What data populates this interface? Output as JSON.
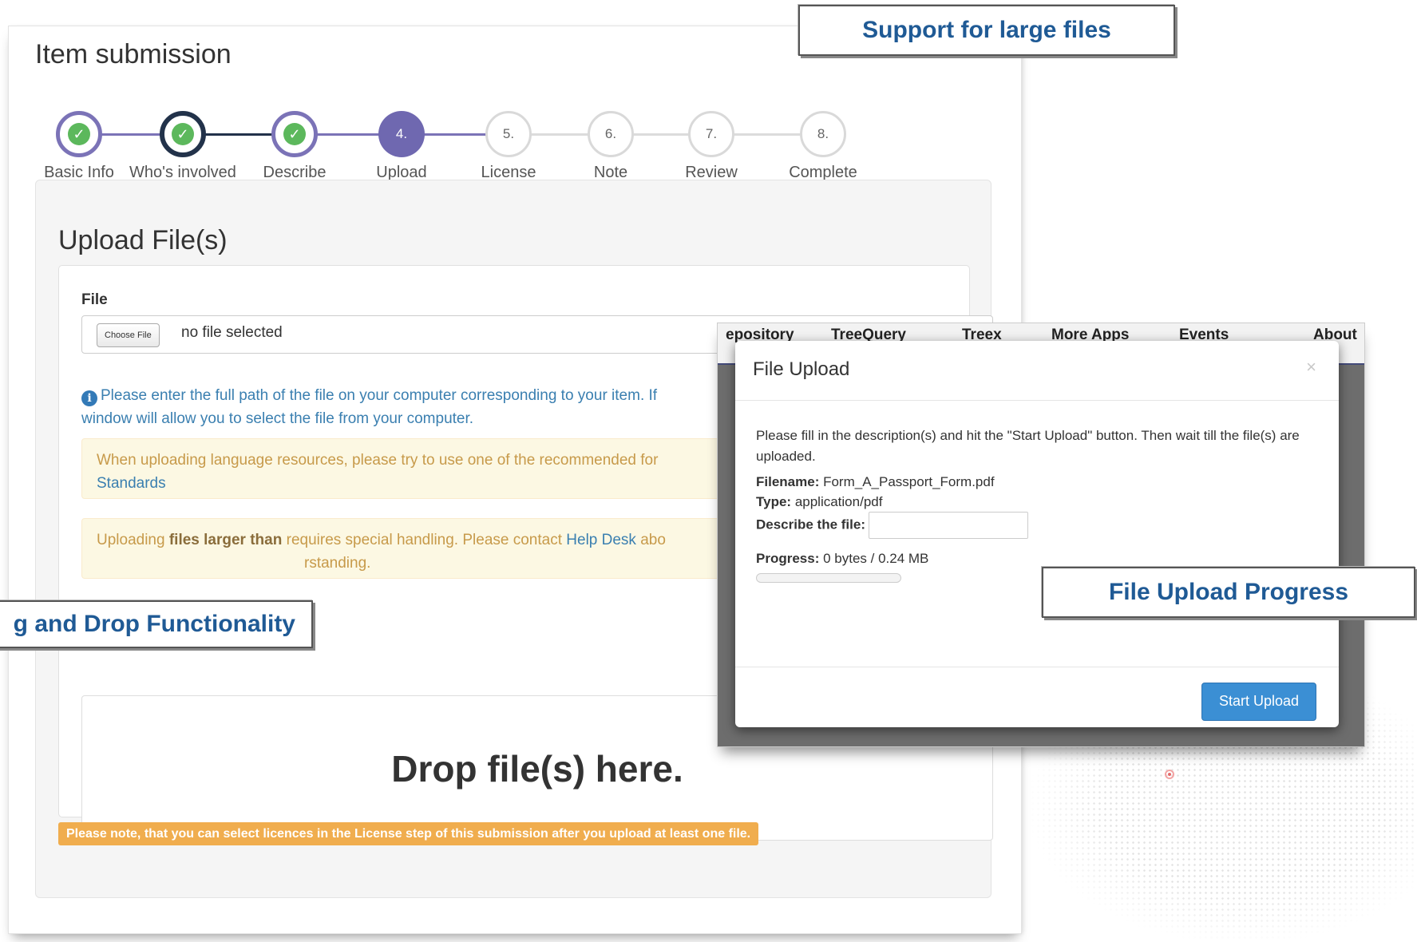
{
  "page": {
    "title": "Item submission"
  },
  "steps": [
    {
      "label": "Basic Info",
      "number": "",
      "state": "done"
    },
    {
      "label": "Who's involved",
      "number": "",
      "state": "done-dark"
    },
    {
      "label": "Describe",
      "number": "",
      "state": "done"
    },
    {
      "label": "Upload",
      "number": "4.",
      "state": "current"
    },
    {
      "label": "License",
      "number": "5.",
      "state": "todo"
    },
    {
      "label": "Note",
      "number": "6.",
      "state": "todo"
    },
    {
      "label": "Review",
      "number": "7.",
      "state": "todo"
    },
    {
      "label": "Complete",
      "number": "8.",
      "state": "todo"
    }
  ],
  "upload": {
    "heading": "Upload File(s)",
    "file_label": "File",
    "choose_button": "Choose File",
    "no_file": "no file selected",
    "help_text_1": "Please enter the full path of the file on your computer corresponding to your item. If",
    "help_text_2": "window will allow you to select the file from your computer.",
    "alert1_text": "When uploading language resources, please try to use one of the recommended for",
    "alert1_link": "Standards",
    "alert2_prefix": "Uploading ",
    "alert2_bold": "files larger than",
    "alert2_mid": " requires special handling. Please contact ",
    "alert2_link": "Help Desk",
    "alert2_suffix": " abo",
    "alert2_line2": "rstanding.",
    "drop_text": "Drop file(s) here.",
    "licence_note": "Please note, that you can select licences in the License step of this submission after you upload at least one file."
  },
  "modal": {
    "nav_items": [
      "epository",
      "TreeQuery",
      "Treex",
      "More Apps",
      "Events",
      "About"
    ],
    "title": "File Upload",
    "close": "×",
    "instructions": "Please fill in the description(s) and hit the \"Start Upload\" button. Then wait till the file(s) are uploaded.",
    "filename_label": "Filename:",
    "filename": "Form_A_Passport_Form.pdf",
    "type_label": "Type:",
    "type": "application/pdf",
    "describe_label": "Describe the file:",
    "progress_label": "Progress:",
    "progress_text": "0 bytes / 0.24 MB",
    "progress_fraction": 0,
    "start_button": "Start Upload"
  },
  "callouts": {
    "large_files": "Support for large files",
    "drag_drop": "g and Drop Functionality",
    "upload_progress": "File Upload Progress"
  },
  "colors": {
    "accent": "#6f68b0",
    "callout_text": "#1f5a95",
    "primary_button": "#3b8fd4",
    "warning": "#f0ad4e"
  }
}
